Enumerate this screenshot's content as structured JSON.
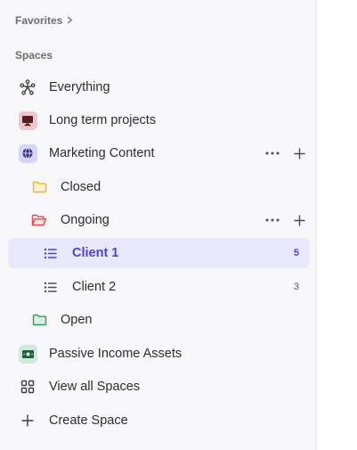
{
  "sidebar": {
    "favorites_label": "Favorites",
    "spaces_label": "Spaces",
    "items": [
      {
        "label": "Everything",
        "icon": "everything-icon"
      },
      {
        "label": "Long term projects",
        "icon": "monitor-icon",
        "color": "#f1c6c8"
      },
      {
        "label": "Marketing Content",
        "icon": "globe-icon",
        "color": "#d7d4f7"
      },
      {
        "label": "Closed",
        "icon": "folder-icon",
        "color": "#f0b429"
      },
      {
        "label": "Ongoing",
        "icon": "folder-open-icon",
        "color": "#e5484d"
      },
      {
        "label": "Client 1",
        "icon": "list-icon",
        "count": "5",
        "active": true
      },
      {
        "label": "Client 2",
        "icon": "list-icon",
        "count": "3"
      },
      {
        "label": "Open",
        "icon": "folder-icon",
        "color": "#2a9d5c"
      },
      {
        "label": "Passive Income Assets",
        "icon": "money-icon",
        "color": "#cfe9dd"
      },
      {
        "label": "View all Spaces",
        "icon": "grid-icon"
      },
      {
        "label": "Create Space",
        "icon": "plus-icon"
      }
    ]
  },
  "colors": {
    "accent": "#4f44c9",
    "active_bg": "#e9e7fb",
    "sidebar_bg": "#f8f8fa"
  }
}
